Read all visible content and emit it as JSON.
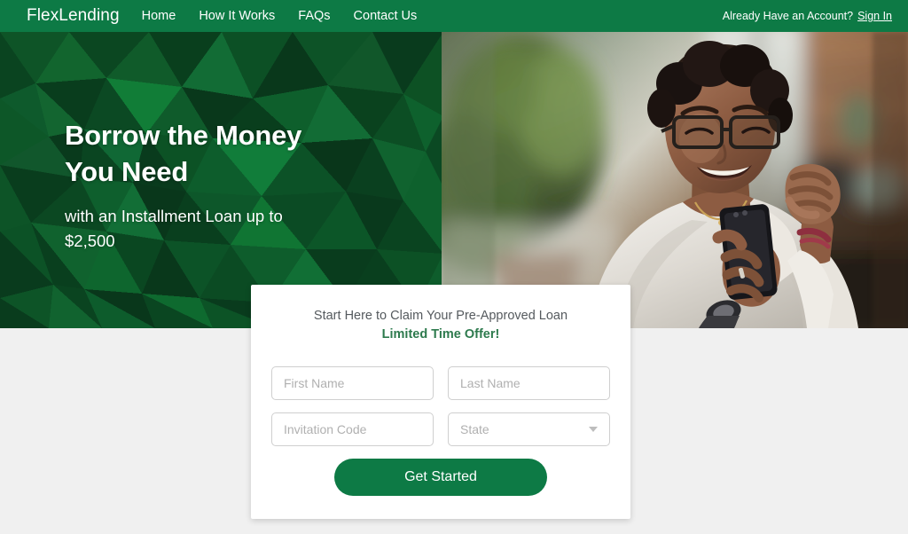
{
  "brand": {
    "name": "FlexLending"
  },
  "nav": {
    "links": [
      {
        "label": "Home"
      },
      {
        "label": "How It Works"
      },
      {
        "label": "FAQs"
      },
      {
        "label": "Contact Us"
      }
    ],
    "account_prompt": "Already Have an Account?",
    "signin_label": "Sign In"
  },
  "hero": {
    "title_line1": "Borrow the Money",
    "title_line2": "You Need",
    "subtitle_line1": "with an Installment Loan up to",
    "subtitle_line2": "$2,500",
    "photo_alt": "smiling-woman-with-glasses-holding-phone"
  },
  "form": {
    "heading": "Start Here to Claim Your Pre-Approved Loan",
    "subheading": "Limited Time Offer!",
    "fields": {
      "first_name": {
        "placeholder": "First Name",
        "value": ""
      },
      "last_name": {
        "placeholder": "Last Name",
        "value": ""
      },
      "invitation_code": {
        "placeholder": "Invitation Code",
        "value": ""
      },
      "state": {
        "placeholder": "State",
        "value": ""
      }
    },
    "submit_label": "Get Started"
  },
  "colors": {
    "brand_green": "#0d7a45",
    "hero_green_dark": "#0a3d20",
    "hero_green_light": "#1d8a3c",
    "offer_green": "#2d7a4d",
    "page_background": "#f0f0f0",
    "card_background": "#ffffff",
    "input_border": "#cfcfcf",
    "placeholder_text": "#b0b0b0"
  }
}
